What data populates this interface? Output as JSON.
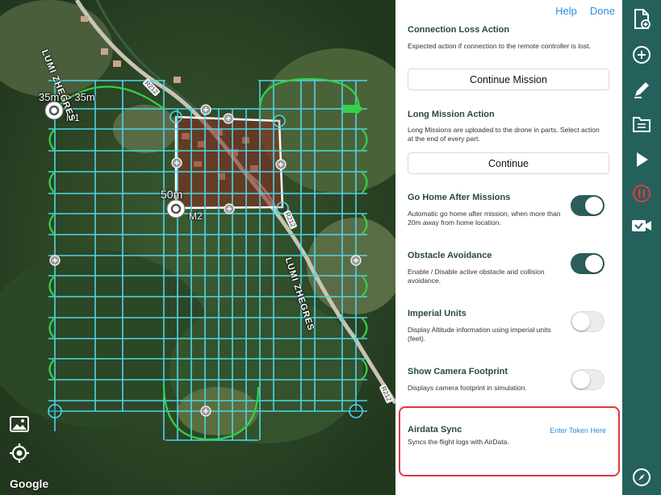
{
  "map": {
    "labels": {
      "spacing": "35m -> 35m",
      "altitude": "50m",
      "marker1": "M1",
      "marker2": "M2"
    },
    "roads": {
      "name_top": "LUMI ZHEGRES",
      "name_mid": "LUMI ZHEGRES",
      "num_a": "R212",
      "num_b": "R212",
      "num_c": "R212"
    },
    "attribution": "Google",
    "icons": {
      "gallery": "image-icon",
      "locate": "location-target-icon"
    },
    "colors": {
      "grid": "#4fd6e8",
      "turns": "#35d04a",
      "area": "#ffffff"
    }
  },
  "panel": {
    "help": "Help",
    "done": "Done",
    "connection_loss": {
      "title": "Connection Loss Action",
      "desc": "Expected action if connection to the remote controller is lost.",
      "button": "Continue Mission"
    },
    "long_mission": {
      "title": "Long Mission Action",
      "desc": "Long Missions are uploaded to the drone in parts. Select action at the end of every part.",
      "button": "Continue"
    },
    "toggles": [
      {
        "title": "Go Home After Missions",
        "desc": "Automatic go home after mission, when more than 20m away from home location.",
        "on": true
      },
      {
        "title": "Obstacle Avoidance",
        "desc": "Enable / Disable active obstacle and collision avoidance.",
        "on": true
      },
      {
        "title": "Imperial Units",
        "desc": "Display Altitude information using imperial units (feet).",
        "on": false
      },
      {
        "title": "Show Camera Footprint",
        "desc": "Displays camera footprint in simulation.",
        "on": false
      }
    ],
    "airdata": {
      "title": "Airdata Sync",
      "desc": "Syncs the flight logs with AirData.",
      "link": "Enter Token Here"
    }
  },
  "toolbar": {
    "background": "#25615c",
    "icons": [
      "new-document-icon",
      "add-icon",
      "edit-pen-icon",
      "folder-icon",
      "play-icon",
      "stop-icon",
      "camera-icon",
      "compass-icon"
    ]
  }
}
